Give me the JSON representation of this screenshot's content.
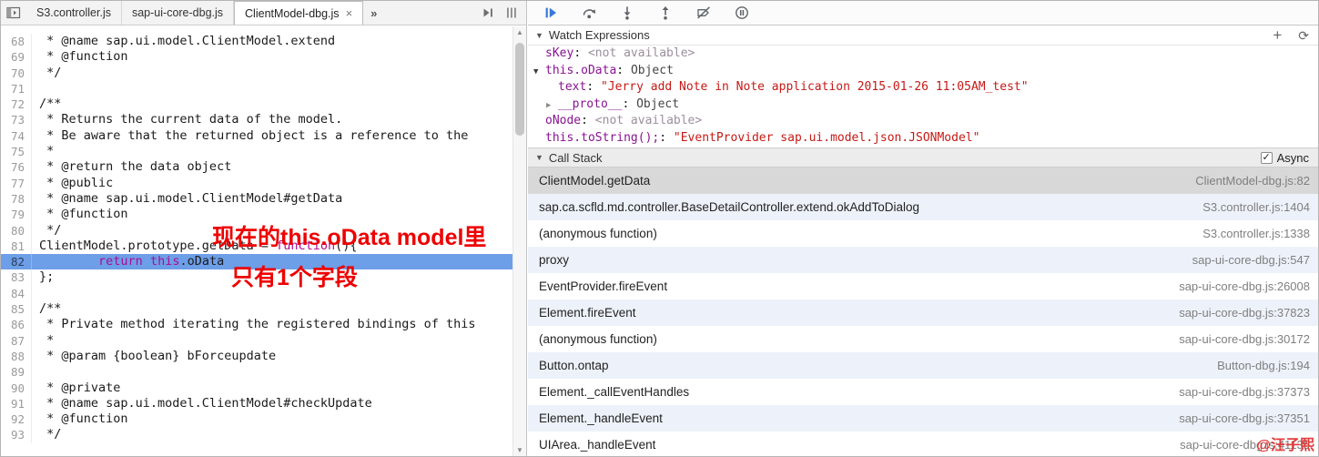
{
  "tabs": {
    "items": [
      {
        "label": "S3.controller.js",
        "active": false,
        "closable": false
      },
      {
        "label": "sap-ui-core-dbg.js",
        "active": false,
        "closable": false
      },
      {
        "label": "ClientModel-dbg.js",
        "active": true,
        "closable": true
      }
    ],
    "close_label": "×",
    "overflow_label": "»"
  },
  "editor": {
    "first_line": 68,
    "execution_line": 82,
    "scrollbar": {
      "up": "▲",
      "down": "▼"
    },
    "lines": [
      {
        "n": 68,
        "exec": false,
        "segs": [
          [
            " * @name sap.ui.model.ClientModel.extend",
            "d"
          ]
        ]
      },
      {
        "n": 69,
        "exec": false,
        "segs": [
          [
            " * @function",
            "d"
          ]
        ]
      },
      {
        "n": 70,
        "exec": false,
        "segs": [
          [
            " */",
            "d"
          ]
        ]
      },
      {
        "n": 71,
        "exec": false,
        "segs": [
          [
            "",
            "d"
          ]
        ]
      },
      {
        "n": 72,
        "exec": false,
        "segs": [
          [
            "/**",
            "d"
          ]
        ]
      },
      {
        "n": 73,
        "exec": false,
        "segs": [
          [
            " * Returns the current data of the model.",
            "d"
          ]
        ]
      },
      {
        "n": 74,
        "exec": false,
        "segs": [
          [
            " * Be aware that the returned object is a reference to the",
            "d"
          ]
        ]
      },
      {
        "n": 75,
        "exec": false,
        "segs": [
          [
            " *",
            "d"
          ]
        ]
      },
      {
        "n": 76,
        "exec": false,
        "segs": [
          [
            " * @return the data object",
            "d"
          ]
        ]
      },
      {
        "n": 77,
        "exec": false,
        "segs": [
          [
            " * @public",
            "d"
          ]
        ]
      },
      {
        "n": 78,
        "exec": false,
        "segs": [
          [
            " * @name sap.ui.model.ClientModel#getData",
            "d"
          ]
        ]
      },
      {
        "n": 79,
        "exec": false,
        "segs": [
          [
            " * @function",
            "d"
          ]
        ]
      },
      {
        "n": 80,
        "exec": false,
        "segs": [
          [
            " */",
            "d"
          ]
        ]
      },
      {
        "n": 81,
        "exec": false,
        "segs": [
          [
            "ClientModel.prototype.getData = ",
            "d"
          ],
          [
            "function",
            "k"
          ],
          [
            "(){",
            "d"
          ]
        ]
      },
      {
        "n": 82,
        "exec": true,
        "segs": [
          [
            "        ",
            "d"
          ],
          [
            "return",
            "k"
          ],
          [
            " ",
            "d"
          ],
          [
            "this",
            "k"
          ],
          [
            ".oData",
            "d"
          ]
        ]
      },
      {
        "n": 83,
        "exec": false,
        "segs": [
          [
            "};",
            "d"
          ]
        ]
      },
      {
        "n": 84,
        "exec": false,
        "segs": [
          [
            "",
            "d"
          ]
        ]
      },
      {
        "n": 85,
        "exec": false,
        "segs": [
          [
            "/**",
            "d"
          ]
        ]
      },
      {
        "n": 86,
        "exec": false,
        "segs": [
          [
            " * Private method iterating the registered bindings of this",
            "d"
          ]
        ]
      },
      {
        "n": 87,
        "exec": false,
        "segs": [
          [
            " *",
            "d"
          ]
        ]
      },
      {
        "n": 88,
        "exec": false,
        "segs": [
          [
            " * @param {boolean} bForceupdate",
            "d"
          ]
        ]
      },
      {
        "n": 89,
        "exec": false,
        "segs": [
          [
            "",
            "d"
          ]
        ]
      },
      {
        "n": 90,
        "exec": false,
        "segs": [
          [
            " * @private",
            "d"
          ]
        ]
      },
      {
        "n": 91,
        "exec": false,
        "segs": [
          [
            " * @name sap.ui.model.ClientModel#checkUpdate",
            "d"
          ]
        ]
      },
      {
        "n": 92,
        "exec": false,
        "segs": [
          [
            " * @function",
            "d"
          ]
        ]
      },
      {
        "n": 93,
        "exec": false,
        "segs": [
          [
            " */",
            "d"
          ]
        ]
      }
    ],
    "annotation": {
      "line1": "现在的this.oData model里",
      "line2": "只有1个字段",
      "color": "#ee0000"
    }
  },
  "debugger_toolbar": {
    "buttons": [
      "resume",
      "step-over",
      "step-into",
      "step-out",
      "deactivate-breakpoints",
      "pause-on-exceptions"
    ],
    "resume_color": "#3879d9",
    "icon_color": "#5f6368"
  },
  "watch": {
    "title": "Watch Expressions",
    "collapse_glyph": "▼",
    "add_label": "+",
    "refresh_label": "⟳",
    "separator": ": ",
    "rows": [
      {
        "indent": 0,
        "arrow": "",
        "name": "sKey",
        "value": "<not available>",
        "vtype": "na"
      },
      {
        "indent": 0,
        "arrow": "▼",
        "name": "this.oData",
        "value": "Object",
        "vtype": "obj"
      },
      {
        "indent": 1,
        "arrow": "",
        "name": "text",
        "value": "\"Jerry add Note in Note application 2015-01-26 11:05AM_test\"",
        "vtype": "str"
      },
      {
        "indent": 1,
        "arrow": "▶",
        "name": "__proto__",
        "value": "Object",
        "vtype": "obj"
      },
      {
        "indent": 0,
        "arrow": "",
        "name": "oNode",
        "value": "<not available>",
        "vtype": "na"
      },
      {
        "indent": 0,
        "arrow": "",
        "name": "this.toString();",
        "value": "\"EventProvider sap.ui.model.json.JSONModel\"",
        "vtype": "str"
      }
    ]
  },
  "call_stack": {
    "title": "Call Stack",
    "collapse_glyph": "▼",
    "async_label": "Async",
    "async_checked": true,
    "check_glyph": "✓",
    "frames": [
      {
        "fn": "ClientModel.getData",
        "loc": "ClientModel-dbg.js:82",
        "selected": true
      },
      {
        "fn": "sap.ca.scfld.md.controller.BaseDetailController.extend.okAddToDialog",
        "loc": "S3.controller.js:1404",
        "selected": false
      },
      {
        "fn": "(anonymous function)",
        "loc": "S3.controller.js:1338",
        "selected": false
      },
      {
        "fn": "proxy",
        "loc": "sap-ui-core-dbg.js:547",
        "selected": false
      },
      {
        "fn": "EventProvider.fireEvent",
        "loc": "sap-ui-core-dbg.js:26008",
        "selected": false
      },
      {
        "fn": "Element.fireEvent",
        "loc": "sap-ui-core-dbg.js:37823",
        "selected": false
      },
      {
        "fn": "(anonymous function)",
        "loc": "sap-ui-core-dbg.js:30172",
        "selected": false
      },
      {
        "fn": "Button.ontap",
        "loc": "Button-dbg.js:194",
        "selected": false
      },
      {
        "fn": "Element._callEventHandles",
        "loc": "sap-ui-core-dbg.js:37373",
        "selected": false
      },
      {
        "fn": "Element._handleEvent",
        "loc": "sap-ui-core-dbg.js:37351",
        "selected": false
      },
      {
        "fn": "UIArea._handleEvent",
        "loc": "sap-ui-core-dbg.js:41135",
        "selected": false
      }
    ]
  },
  "watermark": "@汪子熙"
}
